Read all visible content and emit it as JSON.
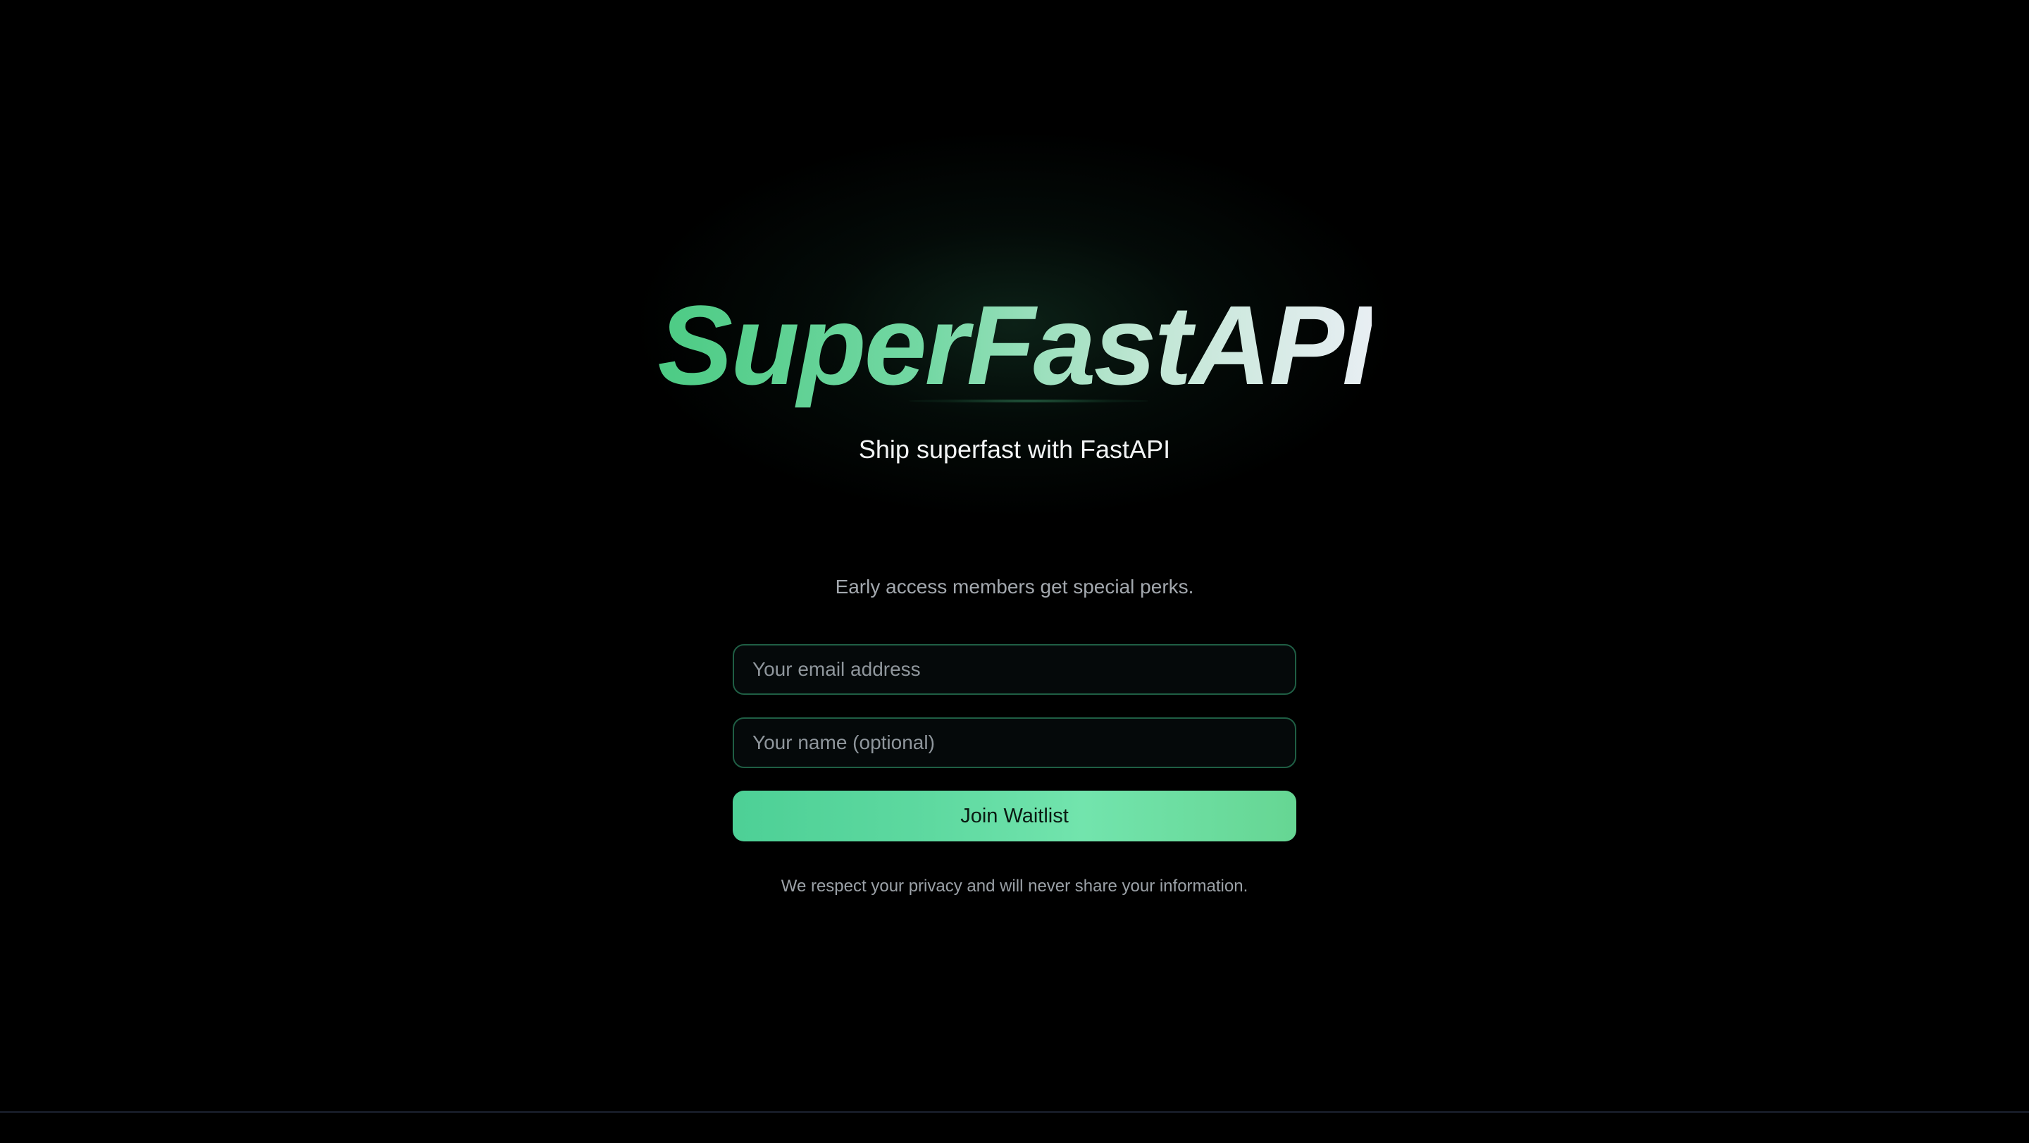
{
  "hero": {
    "title": "SuperFastAPI",
    "tagline": "Ship superfast with FastAPI"
  },
  "waitlist": {
    "perks_text": "Early access members get special perks.",
    "email_placeholder": "Your email address",
    "email_value": "",
    "name_placeholder": "Your name (optional)",
    "name_value": "",
    "submit_label": "Join Waitlist",
    "privacy_note": "We respect your privacy and will never share your information."
  },
  "colors": {
    "background": "#000000",
    "accent_green": "#4fcf87",
    "field_border": "#1f5e44",
    "button_gradient_start": "#4dd096",
    "button_gradient_end": "#66d693"
  }
}
